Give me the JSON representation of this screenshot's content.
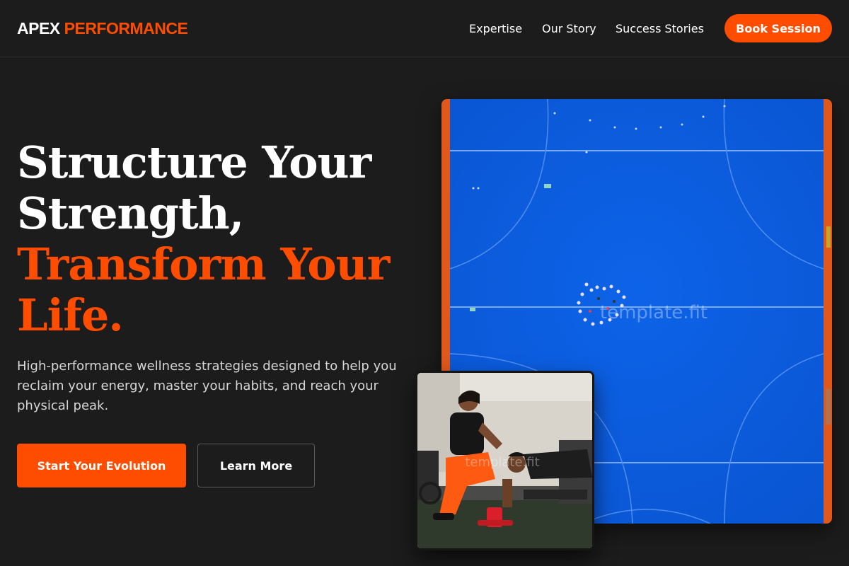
{
  "brand": {
    "part1": "APEX",
    "part2": "PERFORMANCE"
  },
  "nav": {
    "items": [
      {
        "label": "Expertise"
      },
      {
        "label": "Our Story"
      },
      {
        "label": "Success Stories"
      }
    ],
    "cta": "Book Session"
  },
  "hero": {
    "headline_line1": "Structure Your",
    "headline_line2": "Strength,",
    "headline_line3": "Transform Your",
    "headline_line4": "Life.",
    "subtext": "High-performance wellness strategies designed to help you reclaim your energy, master your habits, and reach your physical peak.",
    "primary_button": "Start Your Evolution",
    "secondary_button": "Learn More"
  },
  "images": {
    "court_watermark": "template.fit",
    "trainer_watermark": "template.fit"
  },
  "colors": {
    "accent": "#ff4d00",
    "background": "#1c1c1c",
    "court_blue": "#0a5ce0"
  }
}
